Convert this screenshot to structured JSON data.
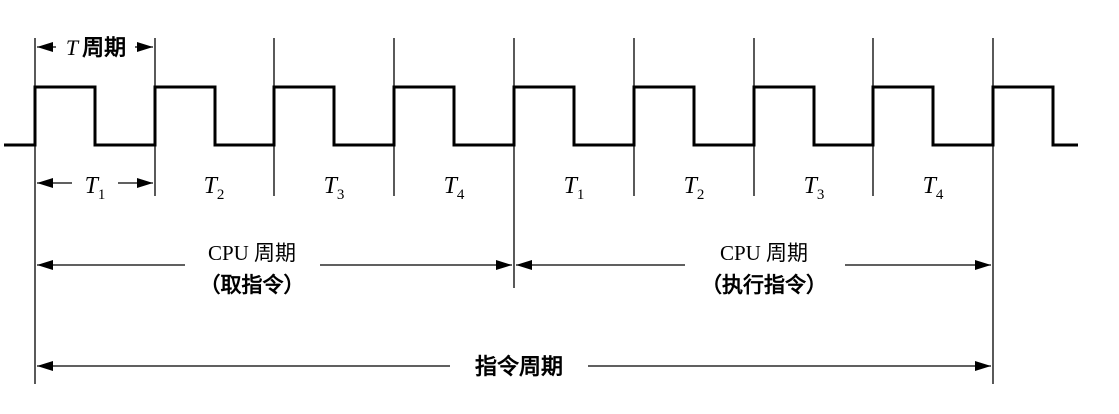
{
  "period_label": {
    "symbol": "T",
    "text": "周期"
  },
  "states": [
    {
      "base": "T",
      "sub": "1"
    },
    {
      "base": "T",
      "sub": "2"
    },
    {
      "base": "T",
      "sub": "3"
    },
    {
      "base": "T",
      "sub": "4"
    },
    {
      "base": "T",
      "sub": "1"
    },
    {
      "base": "T",
      "sub": "2"
    },
    {
      "base": "T",
      "sub": "3"
    },
    {
      "base": "T",
      "sub": "4"
    }
  ],
  "cpu_cycles": [
    {
      "title": "CPU 周期",
      "note": "（取指令）"
    },
    {
      "title": "CPU 周期",
      "note": "（执行指令）"
    }
  ],
  "instruction_cycle": {
    "label": "指令周期"
  },
  "colors": {
    "line": "#000000",
    "background": "#ffffff"
  }
}
